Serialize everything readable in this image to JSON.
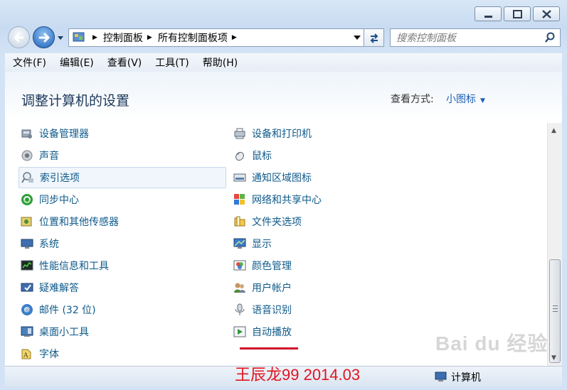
{
  "window": {
    "controls": [
      "minimize-icon",
      "maximize-icon",
      "close-icon"
    ]
  },
  "address": {
    "crumbs": [
      "控制面板",
      "所有控制面板项"
    ],
    "icon": "control-panel-icon"
  },
  "search": {
    "placeholder": "搜索控制面板"
  },
  "menu": [
    "文件(F)",
    "编辑(E)",
    "查看(V)",
    "工具(T)",
    "帮助(H)"
  ],
  "header": {
    "title": "调整计算机的设置",
    "view_by_label": "查看方式:",
    "view_by_value": "小图标"
  },
  "items_left": [
    {
      "label": "设备管理器",
      "icon": "device-manager-icon"
    },
    {
      "label": "声音",
      "icon": "sound-icon"
    },
    {
      "label": "索引选项",
      "icon": "indexing-options-icon"
    },
    {
      "label": "同步中心",
      "icon": "sync-center-icon"
    },
    {
      "label": "位置和其他传感器",
      "icon": "location-sensors-icon"
    },
    {
      "label": "系统",
      "icon": "system-icon"
    },
    {
      "label": "性能信息和工具",
      "icon": "performance-icon"
    },
    {
      "label": "疑难解答",
      "icon": "troubleshooting-icon"
    },
    {
      "label": "邮件 (32 位)",
      "icon": "mail-icon"
    },
    {
      "label": "桌面小工具",
      "icon": "gadgets-icon"
    },
    {
      "label": "字体",
      "icon": "fonts-icon"
    }
  ],
  "items_right": [
    {
      "label": "设备和打印机",
      "icon": "devices-printers-icon"
    },
    {
      "label": "鼠标",
      "icon": "mouse-icon"
    },
    {
      "label": "通知区域图标",
      "icon": "notification-icons-icon"
    },
    {
      "label": "网络和共享中心",
      "icon": "network-sharing-icon"
    },
    {
      "label": "文件夹选项",
      "icon": "folder-options-icon"
    },
    {
      "label": "显示",
      "icon": "display-icon"
    },
    {
      "label": "颜色管理",
      "icon": "color-management-icon"
    },
    {
      "label": "用户帐户",
      "icon": "user-accounts-icon"
    },
    {
      "label": "语音识别",
      "icon": "speech-recognition-icon"
    },
    {
      "label": "自动播放",
      "icon": "autoplay-icon"
    }
  ],
  "status": {
    "computer": "计算机"
  },
  "watermark": {
    "author": "王辰龙99 2014.03",
    "logo": "Bai du 经验"
  },
  "colors": {
    "link": "#0e5a8a",
    "title": "#1e395b",
    "accent_red": "#d0102a"
  }
}
